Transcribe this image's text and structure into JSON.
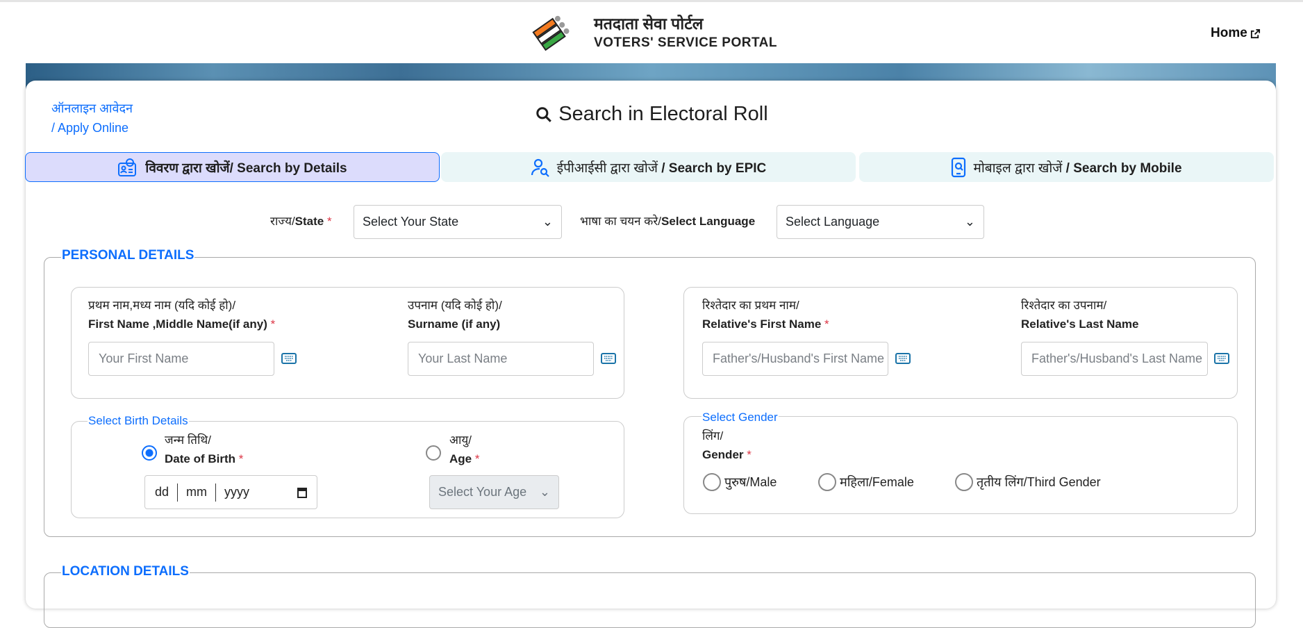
{
  "header": {
    "title_hi": "मतदाता सेवा पोर्टल",
    "title_en": "VOTERS' SERVICE PORTAL",
    "home": "Home"
  },
  "apply_online": {
    "hi": "ऑनलाइन आवेदन",
    "en": "/ Apply Online"
  },
  "page_title": "Search in Electoral Roll",
  "tabs": [
    {
      "hi": "विवरण द्वारा खोजें",
      "en": "/ Search by Details",
      "active": true,
      "icon": "id-card-search-icon"
    },
    {
      "hi": "ईपीआईसी द्वारा खोजें",
      "en": " / Search by EPIC",
      "active": false,
      "icon": "user-search-icon"
    },
    {
      "hi": "मोबाइल द्वारा खोजें",
      "en": " / Search by Mobile",
      "active": false,
      "icon": "mobile-icon"
    }
  ],
  "state": {
    "label_hi": "राज्य/",
    "label_en": "State",
    "required": "*",
    "value": "Select Your State"
  },
  "language": {
    "label_hi": "भाषा का चयन करे/",
    "label_en": "Select Language",
    "value": "Select Language"
  },
  "personal": {
    "legend": "PERSONAL DETAILS",
    "first_name": {
      "hi": "प्रथम नाम,मध्य नाम (यदि कोई हो)/",
      "en": "First Name ,Middle Name(if any)",
      "required": "*",
      "placeholder": "Your First Name"
    },
    "surname": {
      "hi": "उपनाम (यदि कोई हो)/",
      "en": "Surname (if any)",
      "placeholder": "Your Last Name"
    },
    "rel_first": {
      "hi": "रिश्तेदार का प्रथम नाम/",
      "en": "Relative's First Name",
      "required": "*",
      "placeholder": "Father's/Husband's First Name"
    },
    "rel_last": {
      "hi": "रिश्तेदार का उपनाम/",
      "en": "Relative's Last Name",
      "placeholder": "Father's/Husband's Last Name"
    },
    "birth": {
      "legend": "Select Birth Details",
      "dob": {
        "hi": "जन्म तिथि/",
        "en": "Date of Birth",
        "required": "*",
        "selected": true,
        "dd": "dd",
        "mm": "mm",
        "yyyy": "yyyy"
      },
      "age": {
        "hi": "आयु/",
        "en": "Age",
        "required": "*",
        "selected": false,
        "value": "Select Your Age"
      }
    },
    "gender": {
      "legend": "Select Gender",
      "hi": "लिंग/",
      "en": "Gender",
      "required": "*",
      "options": [
        "पुरुष/Male",
        "महिला/Female",
        "तृतीय लिंग/Third Gender"
      ]
    }
  },
  "location": {
    "legend": "LOCATION DETAILS"
  },
  "colors": {
    "accent": "#0d6efd",
    "required": "#dc3545",
    "active_tab_bg": "#dcdcfc",
    "tab_bg": "#eaf6f7"
  }
}
